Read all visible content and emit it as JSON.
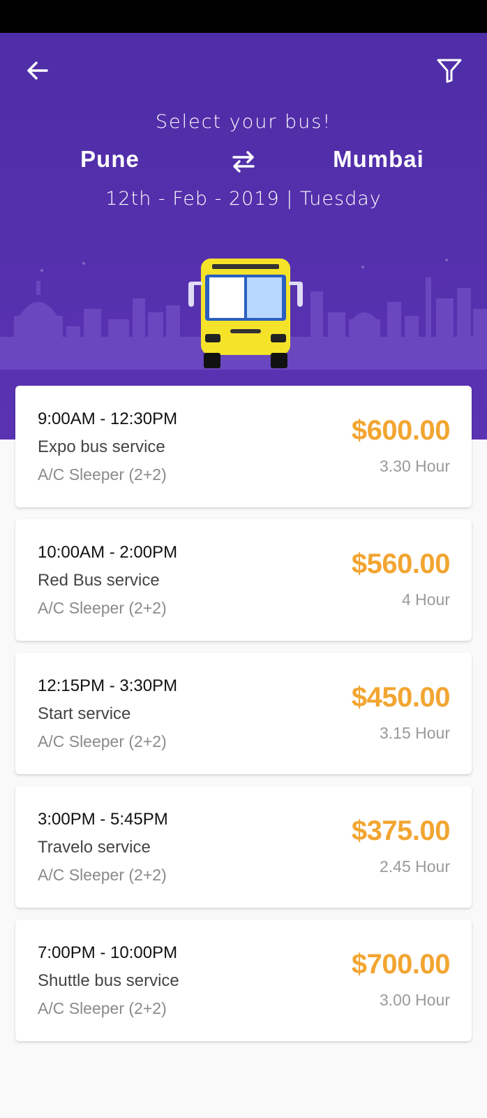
{
  "header": {
    "subtitle": "Select your bus!",
    "from_city": "Pune",
    "to_city": "Mumbai",
    "date_line": "12th - Feb - 2019 | Tuesday",
    "back_icon": "arrow-left-icon",
    "filter_icon": "filter-icon",
    "swap_icon": "swap-arrows-icon"
  },
  "colors": {
    "header_bg": "#5a33b3",
    "price": "#f2a531",
    "bus_body": "#f5e32a"
  },
  "buses": [
    {
      "time": "9:00AM - 12:30PM",
      "operator": "Expo bus service",
      "seat": "A/C Sleeper (2+2)",
      "price": "$600.00",
      "duration": "3.30 Hour"
    },
    {
      "time": "10:00AM - 2:00PM",
      "operator": "Red Bus service",
      "seat": "A/C Sleeper (2+2)",
      "price": "$560.00",
      "duration": "4 Hour"
    },
    {
      "time": "12:15PM - 3:30PM",
      "operator": "Start service",
      "seat": "A/C Sleeper (2+2)",
      "price": "$450.00",
      "duration": "3.15 Hour"
    },
    {
      "time": "3:00PM - 5:45PM",
      "operator": "Travelo service",
      "seat": "A/C Sleeper (2+2)",
      "price": "$375.00",
      "duration": "2.45 Hour"
    },
    {
      "time": "7:00PM - 10:00PM",
      "operator": "Shuttle bus service",
      "seat": "A/C Sleeper (2+2)",
      "price": "$700.00",
      "duration": "3.00 Hour"
    }
  ]
}
